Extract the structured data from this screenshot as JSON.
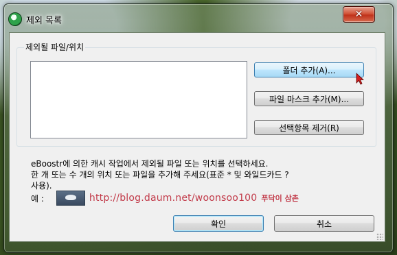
{
  "window": {
    "title": "제외 목록",
    "close_glyph": "✕"
  },
  "group": {
    "label": "제외될 파일/위치",
    "list_items": []
  },
  "buttons": {
    "add_folder": "폴더 추가(A)...",
    "add_file_mask": "파일 마스크 추가(M)...",
    "remove_selected": "선택항목 제거(R)",
    "ok": "확인",
    "cancel": "취소"
  },
  "description": {
    "line1": "eBoostr에 의한 캐시 작업에서 제외될 파일 또는 위치를 선택하세요.",
    "line2": "한 개 또는 수 개의 위치 또는 파일을 추가해 주세요(표준 * 및 와일드카드 ?",
    "line3": "사용)."
  },
  "example": {
    "prefix": "예 :",
    "url": "http://blog.daum.net/woonsoo100",
    "signature": "푸닥이 삼촌"
  },
  "colors": {
    "hot_button": "#bee6fd",
    "close_red": "#c0321a",
    "watermark_red": "#c23b4a"
  }
}
